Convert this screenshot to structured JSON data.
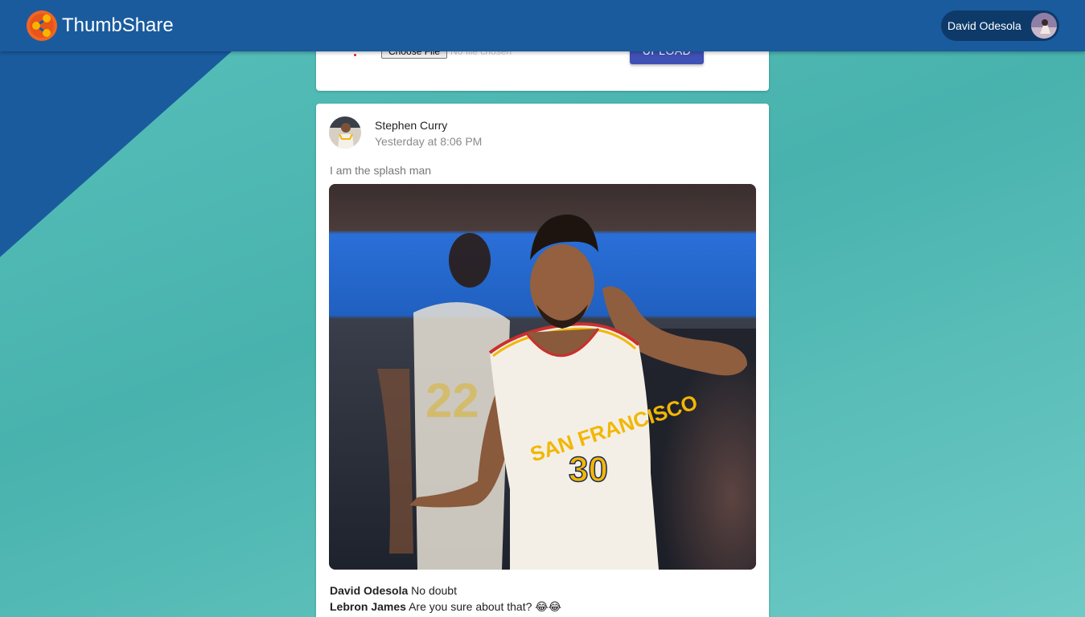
{
  "app": {
    "name": "ThumbShare",
    "colors": {
      "navbar": "#1a5b9e",
      "accent": "#3f51b5",
      "background": "#4fb8b3"
    }
  },
  "header": {
    "user_name": "David Odesola",
    "logo_icon": "thumbshare-logo-icon",
    "avatar_icon": "user-avatar"
  },
  "upload": {
    "choose_file_label": "Choose File",
    "no_file_text": "No file chosen",
    "upload_label": "Upload"
  },
  "post": {
    "author": "Stephen Curry",
    "time": "Yesterday at 8:06 PM",
    "caption": "I am the splash man",
    "image_icon": "basketball-player-photo",
    "comments": [
      {
        "author": "David Odesola",
        "text": "No doubt",
        "emojis": ""
      },
      {
        "author": "Lebron James",
        "text": "Are you sure about that?",
        "emojis": "😂😂"
      }
    ]
  }
}
